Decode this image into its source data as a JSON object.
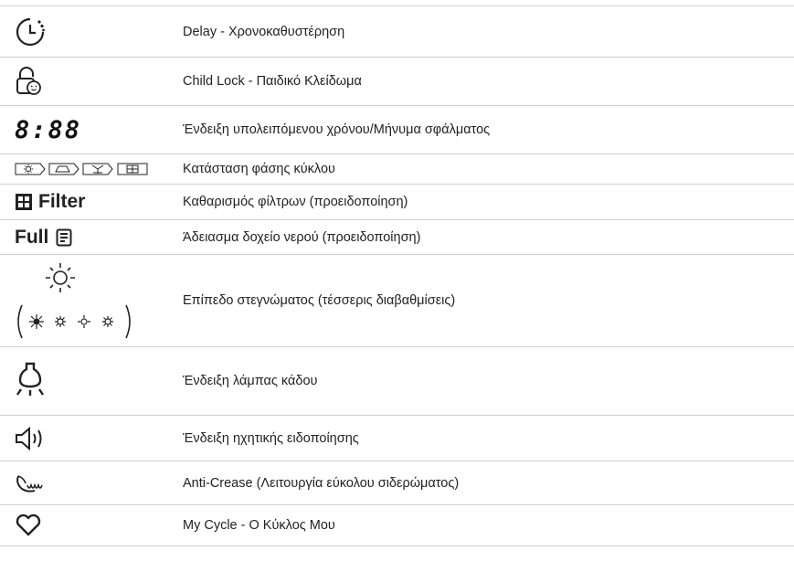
{
  "rows": [
    {
      "icon": "delay-timer-icon",
      "text": "Delay - Χρονοκαθυστέρηση"
    },
    {
      "icon": "child-lock-icon",
      "text": "Child Lock - Παιδικό Κλείδωμα"
    },
    {
      "icon": "digital-display-icon",
      "display_text": "8:88",
      "text": "Ένδειξη υπολειπόμενου χρόνου/Μήνυμα σφάλματος"
    },
    {
      "icon": "cycle-phase-icons",
      "text": "Κατάσταση φάσης κύκλου"
    },
    {
      "icon": "filter-icon",
      "label": "Filter",
      "text": "Καθαρισμός φίλτρων (προειδοποίηση)"
    },
    {
      "icon": "water-container-icon",
      "label": "Full",
      "text": "Άδειασμα δοχείο νερού (προειδοποίηση)"
    },
    {
      "icon": "drying-level-icon",
      "text": "Επίπεδο στεγνώματος (τέσσερις διαβαθμίσεις)"
    },
    {
      "icon": "drum-lamp-icon",
      "text": "Ένδειξη λάμπας κάδου"
    },
    {
      "icon": "sound-alert-icon",
      "text": "Ένδειξη ηχητικής ειδοποίησης"
    },
    {
      "icon": "anti-crease-icon",
      "text": "Anti-Crease (Λειτουργία εύκολου σιδερώματος)"
    },
    {
      "icon": "heart-icon",
      "text": "My Cycle - Ο Κύκλος Μου"
    }
  ]
}
